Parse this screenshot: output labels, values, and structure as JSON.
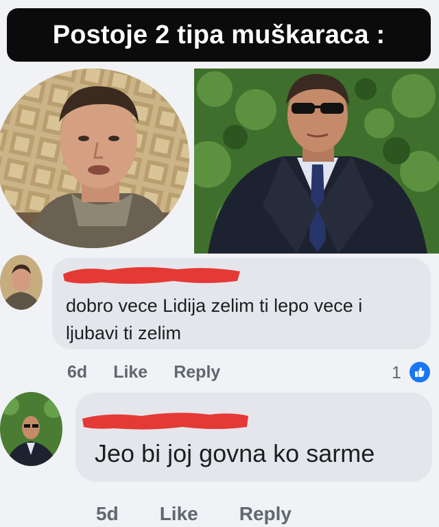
{
  "header": {
    "title": "Postoje 2 tipa muškaraca :"
  },
  "comments": [
    {
      "author_redacted": true,
      "text_line1": "dobro vece Lidija zelim ti lepo vece  i",
      "text_line2": "ljubavi ti zelim",
      "time": "6d",
      "like_label": "Like",
      "reply_label": "Reply",
      "reaction_count": "1",
      "reaction_icon": "thumbs-up-icon"
    },
    {
      "author_redacted": true,
      "text": "Jeo bi joj govna ko sarme",
      "time": "5d",
      "like_label": "Like",
      "reply_label": "Reply"
    }
  ],
  "colors": {
    "title_bg": "#0b0b0b",
    "bubble_bg": "#e4e6eb",
    "redaction": "#e53935",
    "like_blue": "#1877f2",
    "meta_text": "#606770"
  }
}
